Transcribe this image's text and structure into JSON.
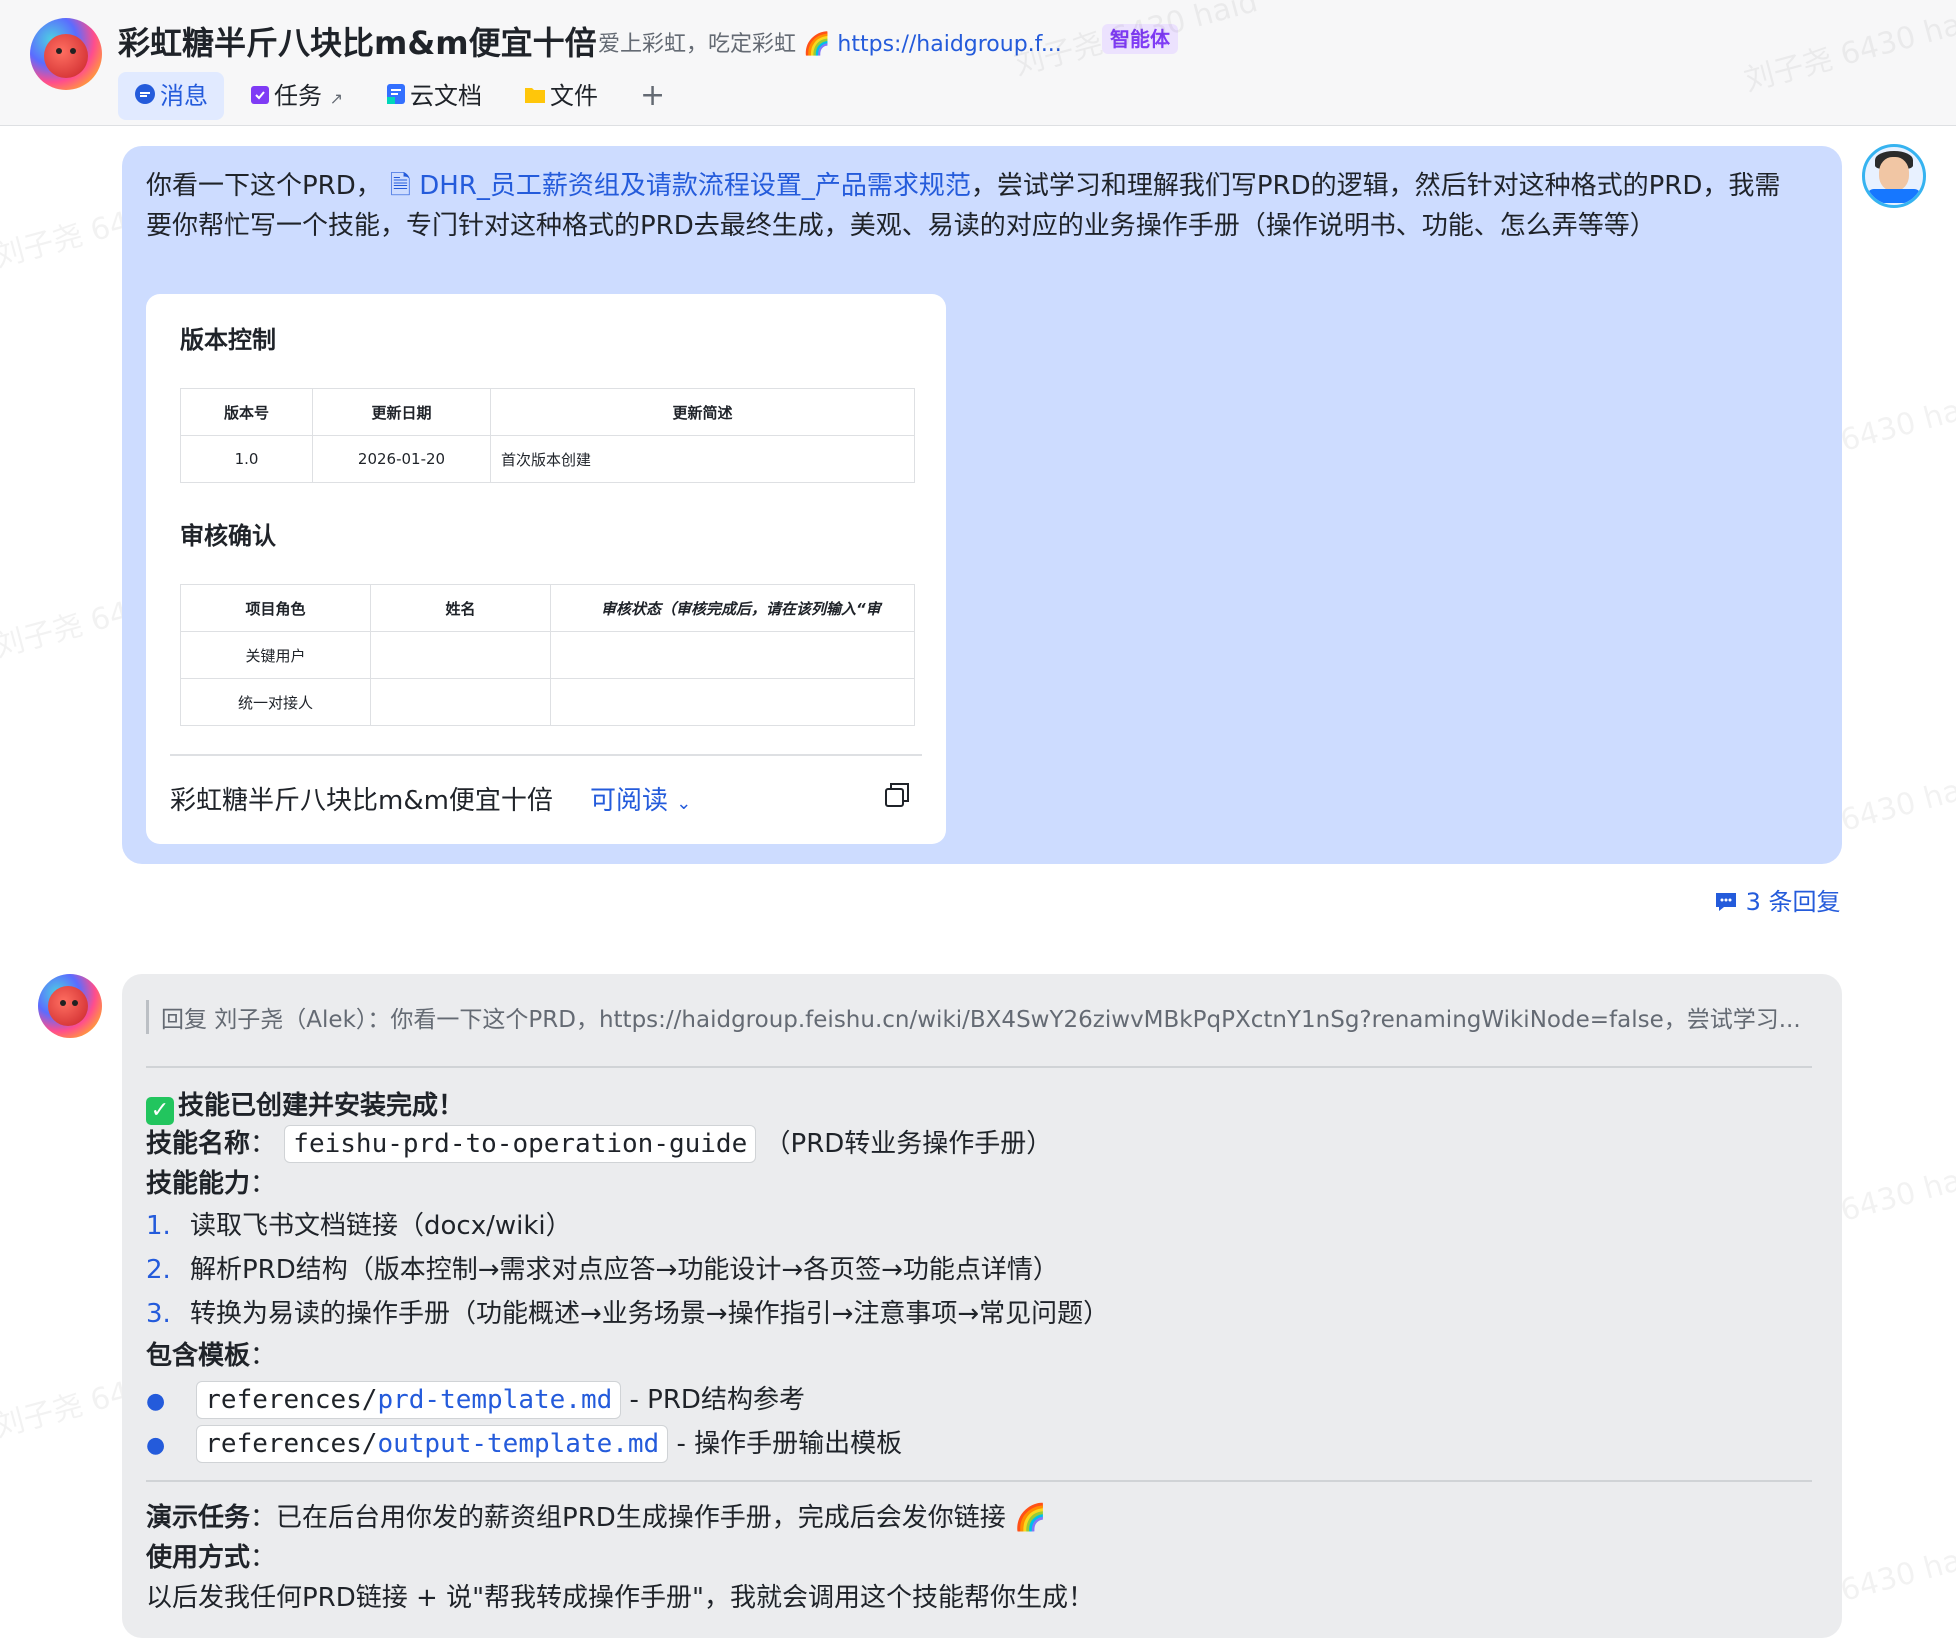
{
  "header": {
    "title": "彩虹糖半斤八块比m&m便宜十倍",
    "subtitle": "爱上彩虹，吃定彩虹",
    "subtitle_link": "https://haidgroup.f...",
    "agent_badge": "智能体",
    "tabs": [
      {
        "label": "消息",
        "icon": "chat-icon"
      },
      {
        "label": "任务",
        "icon": "task-icon"
      },
      {
        "label": "云文档",
        "icon": "doc-icon"
      },
      {
        "label": "文件",
        "icon": "folder-icon"
      }
    ],
    "add_tab": "+"
  },
  "watermark": "刘子尧 6430 haid",
  "user_message": {
    "text_before": "你看一下这个PRD，",
    "doc_link": "DHR_员工薪资组及请款流程设置_产品需求规范",
    "text_after": "，尝试学习和理解我们写PRD的逻辑，然后针对这种格式的PRD，我需要你帮忙写一个技能，专门针对这种格式的PRD去最终生成，美观、易读的对应的业务操作手册（操作说明书、功能、怎么弄等等）",
    "card": {
      "section1_title": "版本控制",
      "table1_headers": [
        "版本号",
        "更新日期",
        "更新简述"
      ],
      "table1_rows": [
        [
          "1.0",
          "2026-01-20",
          "首次版本创建"
        ]
      ],
      "section2_title": "审核确认",
      "table2_headers": [
        "项目角色",
        "姓名",
        "审核状态（审核完成后，请在该列输入“审"
      ],
      "table2_rows": [
        [
          "关键用户",
          "",
          ""
        ],
        [
          "统一对接人",
          "",
          ""
        ]
      ],
      "footer_title": "彩虹糖半斤八块比m&m便宜十倍",
      "footer_permission": "可阅读"
    }
  },
  "reply_count": "3 条回复",
  "bot_message": {
    "quote": "回复 刘子尧（Alek）：你看一下这个PRD，https://haidgroup.feishu.cn/wiki/BX4SwY26ziwvMBkPqPXctnY1nSg?renamingWikiNode=false，尝试学习...",
    "done_title": "技能已创建并安装完成！",
    "skill_name_label": "技能名称",
    "skill_name_sep": "：",
    "skill_name": "feishu-prd-to-operation-guide",
    "skill_name_note": "（PRD转业务操作手册）",
    "ability_label": "技能能力",
    "ability_sep": "：",
    "abilities": [
      {
        "num": "1.",
        "text": "读取飞书文档链接（docx/wiki）"
      },
      {
        "num": "2.",
        "text": "解析PRD结构（版本控制→需求对点应答→功能设计→各页签→功能点详情）"
      },
      {
        "num": "3.",
        "text": "转换为易读的操作手册（功能概述→业务场景→操作指引→注意事项→常见问题）"
      }
    ],
    "template_label": "包含模板",
    "template_sep": "：",
    "templates": [
      {
        "prefix": "references/",
        "file": "prd-template.md",
        "desc": "- PRD结构参考"
      },
      {
        "prefix": "references/",
        "file": "output-template.md",
        "desc": "- 操作手册输出模板"
      }
    ],
    "demo_label": "演示任务",
    "demo_text": "：已在后台用你发的薪资组PRD生成操作手册，完成后会发你链接",
    "usage_label": "使用方式",
    "usage_sep": "：",
    "usage_text": "以后发我任何PRD链接 + 说\"帮我转成操作手册\"，我就会调用这个技能帮你生成！"
  }
}
